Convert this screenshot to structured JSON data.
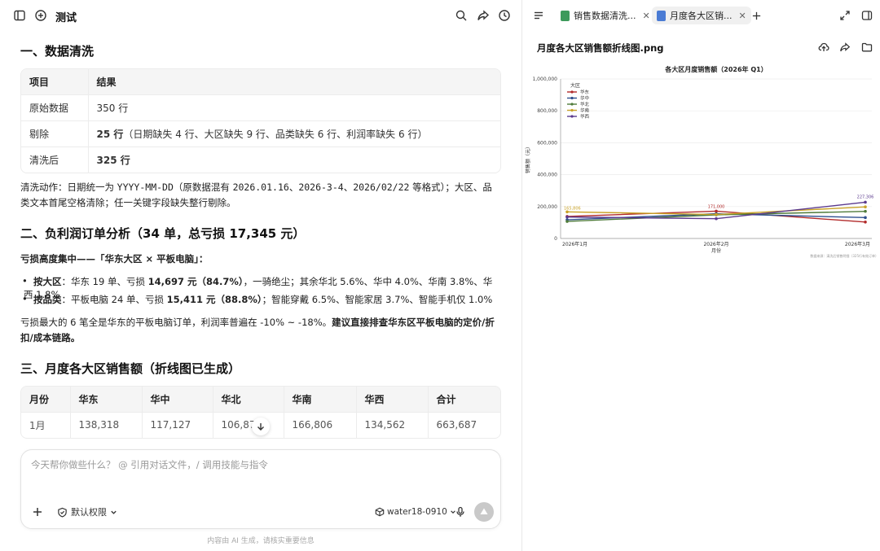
{
  "chat": {
    "title": "测试",
    "section1": {
      "heading": "一、数据清洗",
      "table": {
        "headers": [
          "项目",
          "结果"
        ],
        "rows": [
          [
            "原始数据",
            "350 行"
          ],
          [
            "剔除",
            "25 行",
            "（日期缺失 4 行、大区缺失 9 行、品类缺失 6 行、利润率缺失 6 行）"
          ],
          [
            "清洗后",
            "325 行"
          ]
        ]
      },
      "note": {
        "p1": "清洗动作：日期统一为 ",
        "code1": "YYYY-MM-DD",
        "p2": "（原数据混有 ",
        "code2": "2026.01.16",
        "p3": "、",
        "code3": "2026-3-4",
        "p4": "、",
        "code4": "2026/02/22",
        "p5": " 等格式）；大区、品类文本首尾空格清除；任一关键字段缺失整行剔除。"
      }
    },
    "section2": {
      "heading": "二、负利润订单分析（34 单，总亏损 17,345 元）",
      "lead": "亏损高度集中——「华东大区 × 平板电脑」：",
      "bullets": [
        {
          "label": "按大区",
          "pre": "：华东 19 单、亏损 ",
          "strong": "14,697 元（84.7%）",
          "post": "，一骑绝尘；其余华北 5.6%、华中 4.0%、华南 3.8%、华西 1.8%"
        },
        {
          "label": "按品类",
          "pre": "：平板电脑 24 单、亏损 ",
          "strong": "15,411 元（88.8%）",
          "post": "；智能穿戴 6.5%、智能家居 3.7%、智能手机仅 1.0%"
        }
      ],
      "conclusion": "亏损最大的 6 笔全是华东的平板电脑订单，利润率普遍在 -10% ~ -18%。",
      "conclusion_strong": "建议直接排查华东区平板电脑的定价/折扣/成本链路。"
    },
    "section3": {
      "heading": "三、月度各大区销售额（折线图已生成）",
      "headers": [
        "月份",
        "华东",
        "华中",
        "华北",
        "华南",
        "华西",
        "合计"
      ],
      "rows": [
        [
          "1月",
          "138,318",
          "117,127",
          "106,874",
          "166,806",
          "134,562",
          "663,687"
        ]
      ]
    }
  },
  "composer": {
    "placeholder": "今天帮你做些什么？ @ 引用对话文件，/ 调用技能与指令",
    "permission": "默认权限",
    "model": "water18-0910"
  },
  "footer": "内容由 AI 生成，请核实重要信息",
  "right": {
    "tabs": [
      {
        "label": "销售数据清洗...",
        "color": "#3d9a5b"
      },
      {
        "label": "月度各大区销...",
        "color": "#4a7bd4"
      }
    ],
    "file_name": "月度各大区销售额折线图.png"
  },
  "chart_data": {
    "type": "line",
    "title": "各大区月度销售额（2026年 Q1）",
    "xlabel": "月份",
    "ylabel": "销售额（元）",
    "categories": [
      "2026年1月",
      "2026年2月",
      "2026年3月"
    ],
    "ylim": [
      0,
      1000000
    ],
    "yticks": [
      "0",
      "200,000",
      "400,000",
      "600,000",
      "800,000",
      "1,000,000"
    ],
    "legend_title": "大区",
    "legend_position": "top-left",
    "grid": true,
    "source_note": "数据来源：清洗后销售明细（325行有效订单）",
    "series": [
      {
        "name": "华东",
        "color": "#b22a2a",
        "values": [
          138318,
          171000,
          103000
        ]
      },
      {
        "name": "华中",
        "color": "#2e4f8f",
        "values": [
          117127,
          155000,
          131000
        ]
      },
      {
        "name": "华北",
        "color": "#4f7b3a",
        "values": [
          106874,
          148000,
          170000
        ]
      },
      {
        "name": "华南",
        "color": "#c9a227",
        "values": [
          166806,
          150000,
          198000
        ]
      },
      {
        "name": "华西",
        "color": "#5b3a8e",
        "values": [
          134562,
          124000,
          227306
        ]
      }
    ],
    "labels": [
      "165,806",
      "171,000",
      "227,306"
    ]
  }
}
